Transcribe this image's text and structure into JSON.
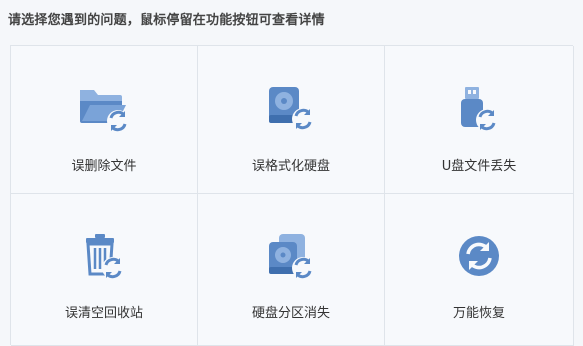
{
  "prompt": "请选择您遇到的问题，鼠标停留在功能按钮可查看详情",
  "colors": {
    "icon_primary": "#5b89c6",
    "icon_light": "#8fb2e0",
    "border": "#dfe4ea",
    "background": "#f7f9fc"
  },
  "options": [
    {
      "label": "误删除文件",
      "icon": "folder-restore-icon"
    },
    {
      "label": "误格式化硬盘",
      "icon": "harddisk-restore-icon"
    },
    {
      "label": "U盘文件丢失",
      "icon": "usb-restore-icon"
    },
    {
      "label": "误清空回收站",
      "icon": "recycle-bin-restore-icon"
    },
    {
      "label": "硬盘分区消失",
      "icon": "partition-restore-icon"
    },
    {
      "label": "万能恢复",
      "icon": "universal-restore-icon"
    }
  ]
}
